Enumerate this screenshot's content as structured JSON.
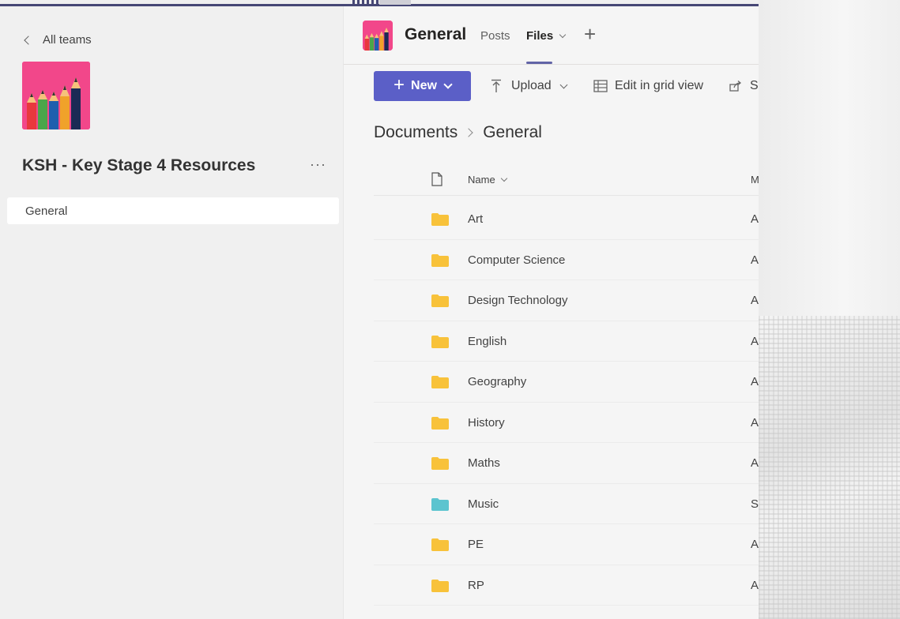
{
  "left": {
    "back_label": "All teams",
    "team_name": "KSH - Key Stage 4 Resources",
    "more_label": "···",
    "channels": [
      "General"
    ]
  },
  "header": {
    "title": "General",
    "tabs": {
      "posts": "Posts",
      "files": "Files"
    },
    "add_tab": "+"
  },
  "toolbar": {
    "new_label": "New",
    "upload_label": "Upload",
    "grid_label": "Edit in grid view",
    "share_label": "S"
  },
  "breadcrumb": {
    "root": "Documents",
    "current": "General"
  },
  "list": {
    "col_name": "Name",
    "col_modified": "M",
    "rows": [
      {
        "name": "Art",
        "modified": "A",
        "color": "#f8c23b"
      },
      {
        "name": "Computer Science",
        "modified": "A",
        "color": "#f8c23b"
      },
      {
        "name": "Design Technology",
        "modified": "A",
        "color": "#f8c23b"
      },
      {
        "name": "English",
        "modified": "A",
        "color": "#f8c23b"
      },
      {
        "name": "Geography",
        "modified": "A",
        "color": "#f8c23b"
      },
      {
        "name": "History",
        "modified": "A",
        "color": "#f8c23b"
      },
      {
        "name": "Maths",
        "modified": "A",
        "color": "#f8c23b"
      },
      {
        "name": "Music",
        "modified": "S",
        "color": "#5cc4cf"
      },
      {
        "name": "PE",
        "modified": "A",
        "color": "#f8c23b"
      },
      {
        "name": "RP",
        "modified": "A",
        "color": "#f8c23b"
      }
    ]
  },
  "colors": {
    "accent": "#5b5fc7",
    "brand_bar": "#464775",
    "logo_bg": "#f2478a"
  }
}
